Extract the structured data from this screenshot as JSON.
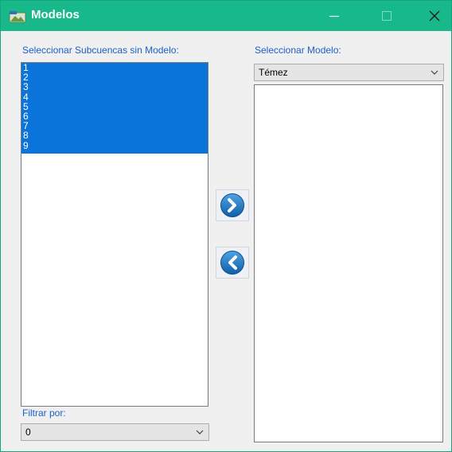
{
  "window": {
    "title": "Modelos",
    "accent_color": "#17b889",
    "icon": "app-window-icon"
  },
  "title_buttons": {
    "minimize_icon": "minimize-icon",
    "maximize_icon": "maximize-icon",
    "close_icon": "close-icon"
  },
  "left_panel": {
    "label": "Seleccionar Subcuencas sin Modelo:",
    "items": [
      "1",
      "2",
      "3",
      "4",
      "5",
      "6",
      "7",
      "8",
      "9"
    ],
    "selected_color": "#0a74da"
  },
  "filter": {
    "label": "Filtrar por:",
    "value": "0"
  },
  "right_panel": {
    "label": "Seleccionar Modelo:",
    "model_value": "Témez",
    "items": []
  },
  "transfer_buttons": {
    "add_icon": "chevron-right-circle-icon",
    "remove_icon": "chevron-left-circle-icon"
  }
}
